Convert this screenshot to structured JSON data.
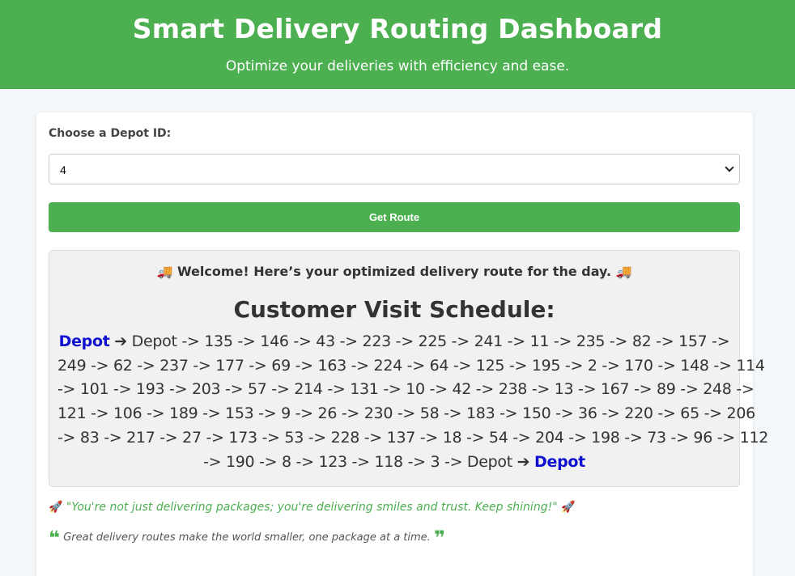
{
  "header": {
    "title": "Smart Delivery Routing Dashboard",
    "subtitle": "Optimize your deliveries with efficiency and ease."
  },
  "form": {
    "depot_label": "Choose a Depot ID:",
    "depot_selected": "4",
    "submit_label": "Get Route"
  },
  "result": {
    "welcome": "Welcome! Here’s your optimized delivery route for the day.",
    "truck_emoji": "🚚",
    "schedule_title": "Customer Visit Schedule:",
    "depot_tag": "Depot",
    "arrow": "➔",
    "route_lines": [
      "Depot -> 135 -> 146 -> 43 -> 223 -> 225 -> 241 -> 11 -> 235 -> 82 -> 157 ->",
      "249 -> 62 -> 237 -> 177 -> 69 -> 163 -> 224 -> 64 -> 125 -> 195 -> 2 -> 170 -> 148 -> 114",
      "-> 101 -> 193 -> 203 -> 57 -> 214 -> 131 -> 10 -> 42 -> 238 -> 13 -> 167 -> 89 -> 248 ->",
      "121 -> 106 -> 189 -> 153 -> 9 -> 26 -> 230 -> 58 -> 183 -> 150 -> 36 -> 220 -> 65 -> 206",
      "-> 83 -> 217 -> 27 -> 173 -> 53 -> 228 -> 137 -> 18 -> 54 -> 204 -> 198 -> 73 -> 96 -> 112",
      "-> 190 -> 8 -> 123 -> 118 -> 3 -> Depot"
    ]
  },
  "footer": {
    "rocket_emoji": "🚀",
    "motto": "\"You're not just delivering packages; you're delivering smiles and trust. Keep shining!\"",
    "quote_open": "❝",
    "quote_close": "❞",
    "quote": "Great delivery routes make the world smaller, one package at a time."
  },
  "colors": {
    "brand": "#4caf50",
    "depot_tag": "#1010d0"
  }
}
